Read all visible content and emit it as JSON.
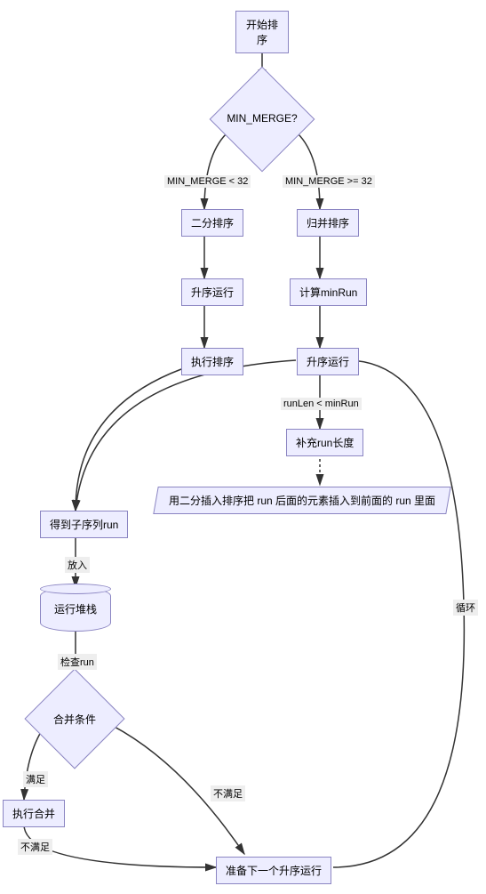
{
  "nodes": {
    "start": "开始排序",
    "minmerge": "MIN_MERGE?",
    "binary_sort": "二分排序",
    "merge_sort": "归并排序",
    "ascend_run_left": "升序运行",
    "calc_minrun": "计算minRun",
    "exec_sort": "执行排序",
    "ascend_run_right": "升序运行",
    "fill_run_len": "补充run长度",
    "binary_insert_note": "用二分插入排序把 run 后面的元素插入到前面的 run 里面",
    "got_sub_run": "得到子序列run",
    "run_stack": "运行堆栈",
    "merge_cond": "合并条件",
    "exec_merge": "执行合并",
    "prep_next": "准备下一个升序运行"
  },
  "edges": {
    "lt32": "MIN_MERGE < 32",
    "ge32": "MIN_MERGE >= 32",
    "runlen_lt_minrun": "runLen < minRun",
    "put_in": "放入",
    "check_run": "检查run",
    "satisfy": "满足",
    "not_satisfy": "不满足",
    "not_satisfy2": "不满足",
    "loop": "循环"
  }
}
